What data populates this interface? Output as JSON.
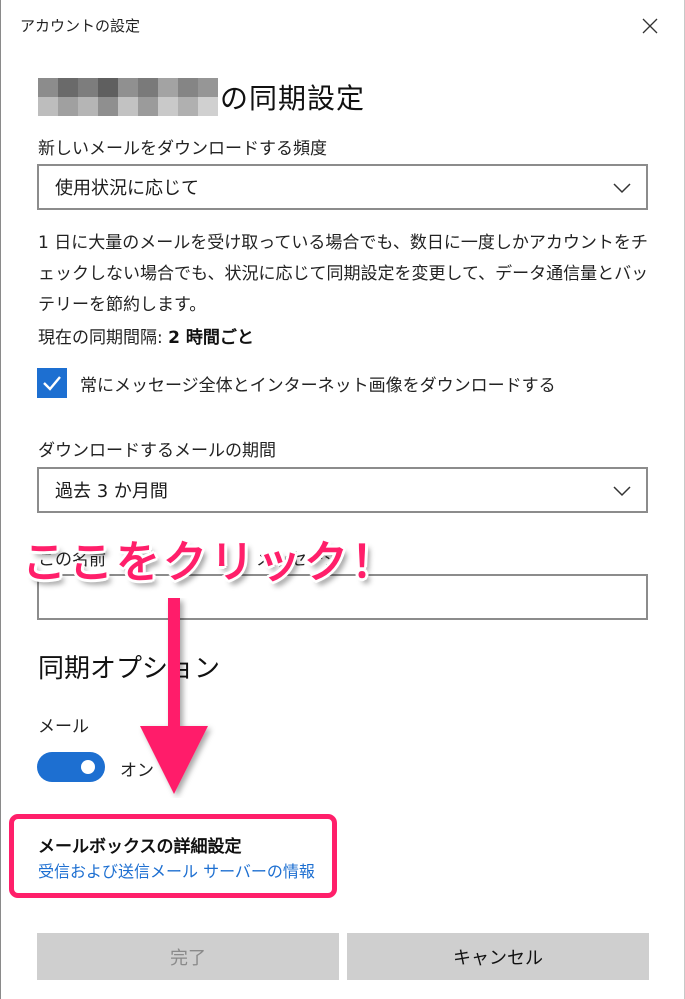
{
  "window": {
    "title": "アカウントの設定",
    "close_icon": "close-icon"
  },
  "heading": {
    "account_name_mosaic": [
      "#8c8c8c",
      "#6a6a6a",
      "#7d7d7d",
      "#5f5f5f",
      "#909090",
      "#7a7a7a",
      "#a3a3a3",
      "#858585",
      "#969696",
      "#bdbdbd",
      "#a0a0a0",
      "#b5b5b5",
      "#8f8f8f",
      "#c2c2c2",
      "#9b9b9b",
      "#c9c9c9",
      "#b0b0b0",
      "#d0d0d0"
    ],
    "suffix": "の同期設定"
  },
  "frequency": {
    "label": "新しいメールをダウンロードする頻度",
    "selected": "使用状況に応じて",
    "description": "1 日に大量のメールを受け取っている場合でも、数日に一度しかアカウントをチェックしない場合でも、状況に応じて同期設定を変更して、データ通信量とバッテリーを節約します。",
    "interval_prefix": "現在の同期間隔: ",
    "interval_value": "2 時間ごと"
  },
  "download_full": {
    "label": "常にメッセージ全体とインターネット画像をダウンロードする",
    "checked": true
  },
  "period": {
    "label": "ダウンロードするメールの期間",
    "selected": "過去 3 か月間"
  },
  "send_name": {
    "label_partial": "この名前",
    "label_partial2": "メッセージ"
  },
  "sync_options": {
    "title": "同期オプション",
    "mail_label": "メール",
    "toggle_state": "オン"
  },
  "advanced": {
    "title": "メールボックスの詳細設定",
    "link": "受信および送信メール サーバーの情報"
  },
  "buttons": {
    "done": "完了",
    "cancel": "キャンセル"
  },
  "annotation": {
    "callout": "ここをクリック！",
    "color": "#ff1f6a"
  },
  "colors": {
    "accent": "#1d6fd1",
    "highlight": "#ff1f6a"
  }
}
